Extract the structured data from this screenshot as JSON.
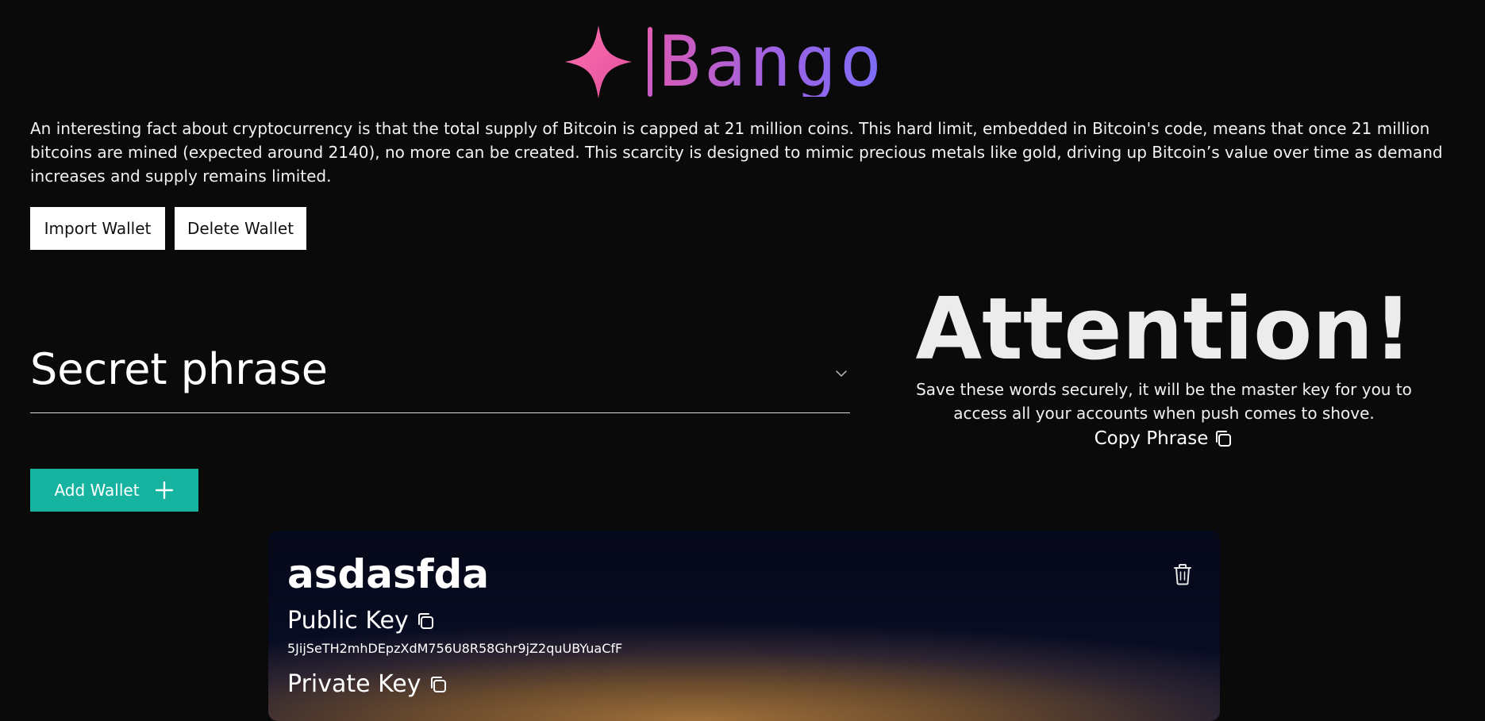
{
  "header": {
    "logo_text": "Bango",
    "logo_icon": "sparkle-icon"
  },
  "fact": "An interesting fact about cryptocurrency is that the total supply of Bitcoin is capped at 21 million coins. This hard limit, embedded in Bitcoin's code, means that once 21 million bitcoins are mined (expected around 2140), no more can be created. This scarcity is designed to mimic precious metals like gold, driving up Bitcoin’s value over time as demand increases and supply remains limited.",
  "actions": {
    "import_label": "Import Wallet",
    "delete_label": "Delete Wallet",
    "add_label": "Add Wallet"
  },
  "secret": {
    "title": "Secret phrase",
    "icon": "chevron-down-icon"
  },
  "attention": {
    "title": "Attention!",
    "message": "Save these words securely, it will be the master key for you to access all your accounts when push comes to shove.",
    "copy_label": "Copy Phrase",
    "copy_icon": "copy-icon"
  },
  "wallet": {
    "name": "asdasfda",
    "public_key_label": "Public Key",
    "public_key": "5JijSeTH2mhDEpzXdM756U8R58Ghr9jZ2quUBYuaCfF",
    "private_key_label": "Private Key",
    "delete_icon": "trash-icon"
  },
  "colors": {
    "background": "#0a0a0a",
    "accent_teal": "#16b3a0",
    "logo_pink": "#f06bb0",
    "logo_violet": "#7c6df6"
  }
}
